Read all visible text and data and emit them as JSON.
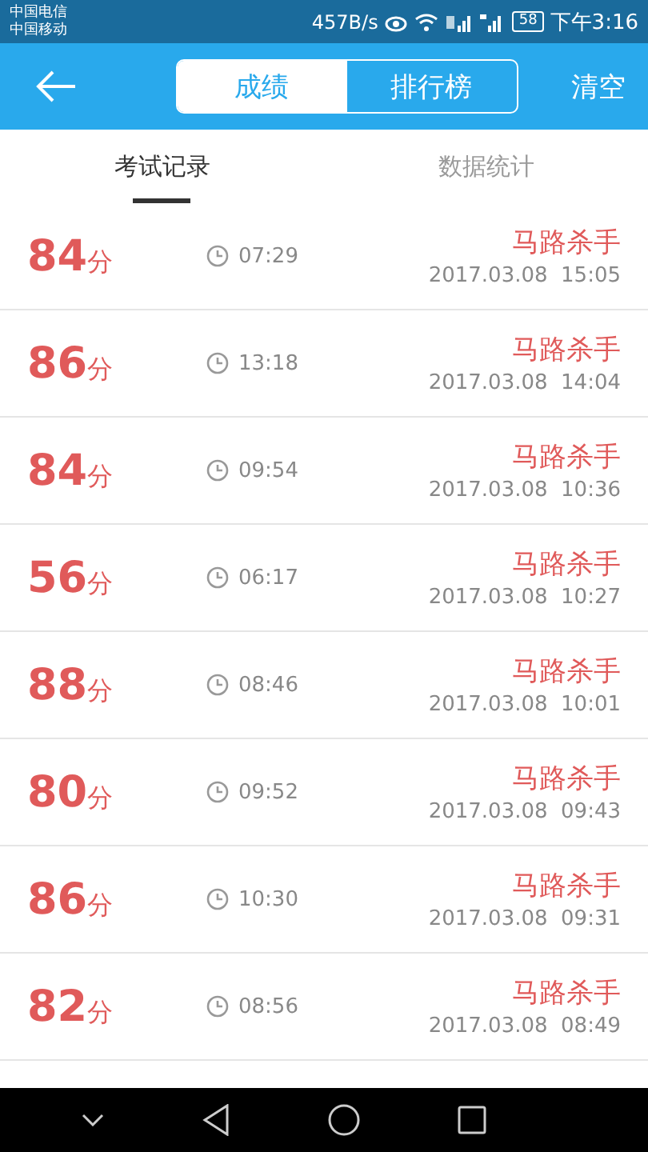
{
  "status_bar": {
    "carriers": [
      "中国电信",
      "中国移动"
    ],
    "net_speed": "457B/s",
    "battery": "58",
    "time": "下午3:16"
  },
  "header": {
    "segments": [
      {
        "label": "成绩",
        "selected": true
      },
      {
        "label": "排行榜",
        "selected": false
      }
    ],
    "action": "清空"
  },
  "tabs": [
    {
      "label": "考试记录",
      "selected": true
    },
    {
      "label": "数据统计",
      "selected": false
    }
  ],
  "records": [
    {
      "score": "84",
      "unit": "分",
      "duration": "07:29",
      "name": "马路杀手",
      "date": "2017.03.08  15:05"
    },
    {
      "score": "86",
      "unit": "分",
      "duration": "13:18",
      "name": "马路杀手",
      "date": "2017.03.08  14:04"
    },
    {
      "score": "84",
      "unit": "分",
      "duration": "09:54",
      "name": "马路杀手",
      "date": "2017.03.08  10:36"
    },
    {
      "score": "56",
      "unit": "分",
      "duration": "06:17",
      "name": "马路杀手",
      "date": "2017.03.08  10:27"
    },
    {
      "score": "88",
      "unit": "分",
      "duration": "08:46",
      "name": "马路杀手",
      "date": "2017.03.08  10:01"
    },
    {
      "score": "80",
      "unit": "分",
      "duration": "09:52",
      "name": "马路杀手",
      "date": "2017.03.08  09:43"
    },
    {
      "score": "86",
      "unit": "分",
      "duration": "10:30",
      "name": "马路杀手",
      "date": "2017.03.08  09:31"
    },
    {
      "score": "82",
      "unit": "分",
      "duration": "08:56",
      "name": "马路杀手",
      "date": "2017.03.08  08:49"
    }
  ]
}
